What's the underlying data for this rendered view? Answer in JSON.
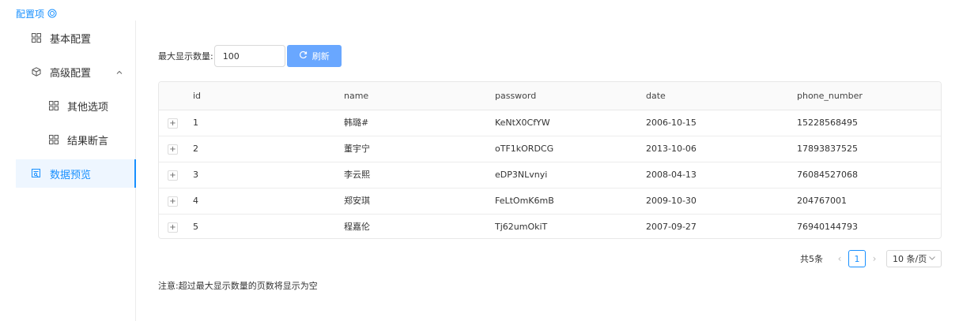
{
  "header": {
    "title": "配置项",
    "icon": "target-icon",
    "accent": "#1890ff"
  },
  "sidebar": {
    "items": [
      {
        "label": "基本配置",
        "icon": "grid-icon",
        "level": 1
      },
      {
        "label": "高级配置",
        "icon": "cube-icon",
        "level": 1,
        "expanded": true
      },
      {
        "label": "其他选项",
        "icon": "grid-icon",
        "level": 2
      },
      {
        "label": "结果断言",
        "icon": "grid-icon",
        "level": 2
      },
      {
        "label": "数据预览",
        "icon": "preview-icon",
        "level": 1,
        "active": true
      }
    ]
  },
  "toolbar": {
    "max_label": "最大显示数量:",
    "max_value": "100",
    "refresh_label": "刷新",
    "refresh_icon": "refresh-icon",
    "button_color": "#69a7ff"
  },
  "table": {
    "columns": [
      "id",
      "name",
      "password",
      "date",
      "phone_number"
    ],
    "rows": [
      {
        "id": "1",
        "name": "韩璐#",
        "password": "KeNtX0CfYW",
        "date": "2006-10-15",
        "phone": "15228568495"
      },
      {
        "id": "2",
        "name": "董宇宁",
        "password": "oTF1kORDCG",
        "date": "2013-10-06",
        "phone": "17893837525"
      },
      {
        "id": "3",
        "name": "李云熙",
        "password": "eDP3NLvnyi",
        "date": "2008-04-13",
        "phone": "76084527068"
      },
      {
        "id": "4",
        "name": "郑安琪",
        "password": "FeLtOmK6mB",
        "date": "2009-10-30",
        "phone": "204767001"
      },
      {
        "id": "5",
        "name": "程嘉伦",
        "password": "Tj62umOkiT",
        "date": "2007-09-27",
        "phone": "76940144793"
      }
    ],
    "expand_symbol": "+"
  },
  "pagination": {
    "total": "共5条",
    "current": "1",
    "page_size": "10 条/页",
    "prev": "‹",
    "next": "›"
  },
  "note": "注意:超过最大显示数量的页数将显示为空"
}
